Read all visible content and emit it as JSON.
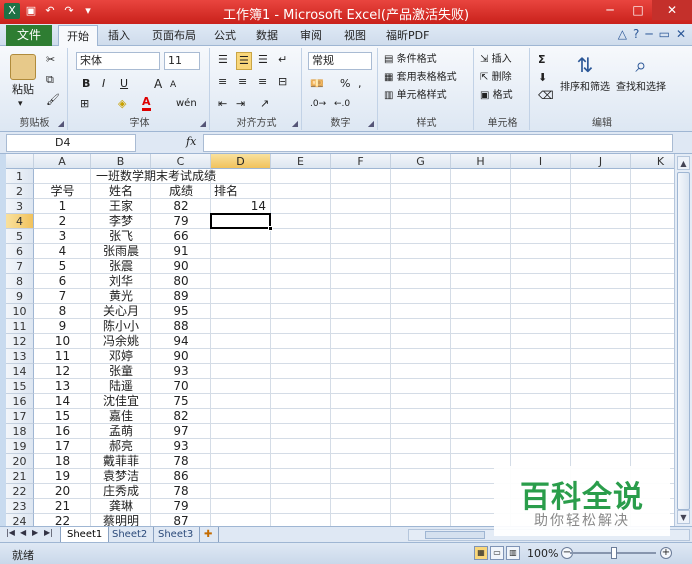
{
  "window": {
    "title": "工作簿1 - Microsoft Excel(产品激活失败)",
    "controls": {
      "minimize": "─",
      "maximize": "□",
      "close": "✕"
    }
  },
  "tabs": {
    "file": "文件",
    "items": [
      "开始",
      "插入",
      "页面布局",
      "公式",
      "数据",
      "审阅",
      "视图",
      "福昕PDF"
    ],
    "active": "开始"
  },
  "ribbon": {
    "clipboard": {
      "label": "剪贴板",
      "paste": "粘贴"
    },
    "font": {
      "label": "字体",
      "name": "宋体",
      "size": "11",
      "bold": "B",
      "italic": "I",
      "underline": "U",
      "grow": "A",
      "shrink": "A",
      "phonetic": "wén"
    },
    "alignment": {
      "label": "对齐方式"
    },
    "number": {
      "label": "数字",
      "format": "常规",
      "percent": "%",
      "comma": ","
    },
    "styles": {
      "label": "样式",
      "conditional": "条件格式",
      "table": "套用表格格式",
      "cell": "单元格样式"
    },
    "cells": {
      "label": "单元格",
      "insert": "插入",
      "delete": "删除",
      "format": "格式"
    },
    "editing": {
      "label": "编辑",
      "sum": "Σ",
      "sort": "排序和筛选",
      "find": "查找和选择"
    }
  },
  "formula_bar": {
    "name_box": "D4",
    "fx": "fx",
    "content": ""
  },
  "columns": [
    "A",
    "B",
    "C",
    "D",
    "E",
    "F",
    "G",
    "H",
    "I",
    "J",
    "K"
  ],
  "selected_column": "D",
  "selected_row": "4",
  "rows": [
    "1",
    "2",
    "3",
    "4",
    "5",
    "6",
    "7",
    "8",
    "9",
    "10",
    "11",
    "12",
    "13",
    "14",
    "15",
    "16",
    "17",
    "18",
    "19",
    "20",
    "21",
    "22",
    "23",
    "24"
  ],
  "sheet": {
    "title": "一班数学期末考试成绩",
    "headers": {
      "id": "学号",
      "name": "姓名",
      "score": "成绩",
      "rank": "排名"
    },
    "rank_value": "14",
    "students": [
      {
        "id": "1",
        "name": "王家",
        "score": "82"
      },
      {
        "id": "2",
        "name": "李梦",
        "score": "79"
      },
      {
        "id": "3",
        "name": "张飞",
        "score": "66"
      },
      {
        "id": "4",
        "name": "张雨晨",
        "score": "91"
      },
      {
        "id": "5",
        "name": "张震",
        "score": "90"
      },
      {
        "id": "6",
        "name": "刘华",
        "score": "80"
      },
      {
        "id": "7",
        "name": "黄光",
        "score": "89"
      },
      {
        "id": "8",
        "name": "关心月",
        "score": "95"
      },
      {
        "id": "9",
        "name": "陈小小",
        "score": "88"
      },
      {
        "id": "10",
        "name": "冯余姚",
        "score": "94"
      },
      {
        "id": "11",
        "name": "邓婷",
        "score": "90"
      },
      {
        "id": "12",
        "name": "张童",
        "score": "93"
      },
      {
        "id": "13",
        "name": "陆遥",
        "score": "70"
      },
      {
        "id": "14",
        "name": "沈佳宜",
        "score": "75"
      },
      {
        "id": "15",
        "name": "嘉佳",
        "score": "82"
      },
      {
        "id": "16",
        "name": "孟萌",
        "score": "97"
      },
      {
        "id": "17",
        "name": "郝亮",
        "score": "93"
      },
      {
        "id": "18",
        "name": "戴菲菲",
        "score": "78"
      },
      {
        "id": "19",
        "name": "袁梦洁",
        "score": "86"
      },
      {
        "id": "20",
        "name": "庄秀成",
        "score": "78"
      },
      {
        "id": "21",
        "name": "龚琳",
        "score": "79"
      },
      {
        "id": "22",
        "name": "蔡明明",
        "score": "87"
      }
    ]
  },
  "sheet_tabs": [
    "Sheet1",
    "Sheet2",
    "Sheet3"
  ],
  "active_sheet": "Sheet1",
  "status": {
    "ready": "就绪",
    "zoom": "100%"
  },
  "watermark": {
    "main": "百科全说",
    "sub": "助你轻松解决"
  }
}
